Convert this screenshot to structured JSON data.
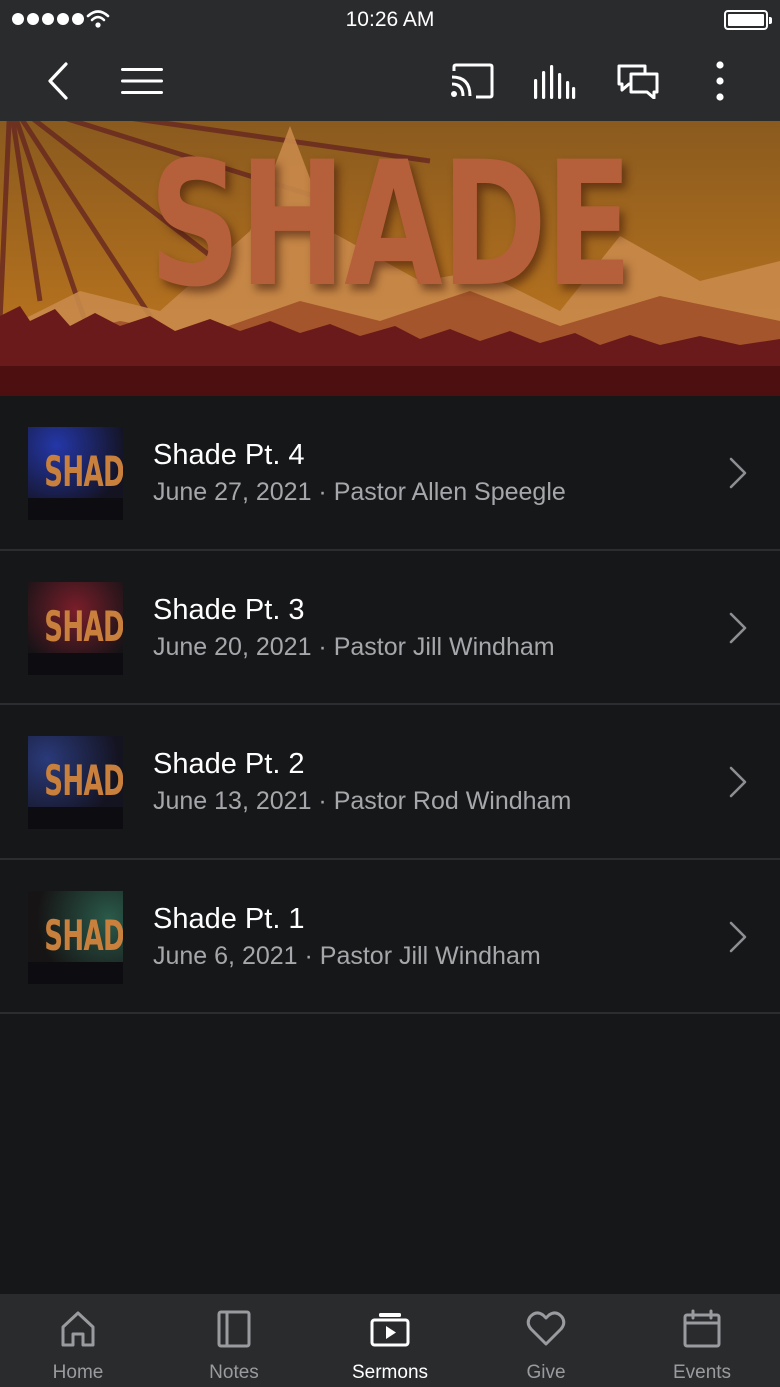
{
  "status_bar": {
    "time": "10:26 AM"
  },
  "hero": {
    "title": "SHADE"
  },
  "sermons": [
    {
      "title": "Shade Pt. 4",
      "subtitle": "June 27, 2021 · Pastor Allen Speegle",
      "thumb_text": "SHADE",
      "thumb_accent": "#2437a8"
    },
    {
      "title": "Shade Pt. 3",
      "subtitle": "June 20, 2021 · Pastor Jill Windham",
      "thumb_text": "SHADE",
      "thumb_accent": "#7a1e2a"
    },
    {
      "title": "Shade Pt. 2",
      "subtitle": "June 13, 2021 · Pastor Rod Windham",
      "thumb_text": "SHADE",
      "thumb_accent": "#2a3a7a"
    },
    {
      "title": "Shade Pt. 1",
      "subtitle": "June 6, 2021 · Pastor Jill Windham",
      "thumb_text": "SHADE",
      "thumb_accent": "#2a5a4a"
    }
  ],
  "tabs": [
    {
      "label": "Home",
      "icon": "home-icon",
      "active": false
    },
    {
      "label": "Notes",
      "icon": "notes-icon",
      "active": false
    },
    {
      "label": "Sermons",
      "icon": "sermons-icon",
      "active": true
    },
    {
      "label": "Give",
      "icon": "heart-icon",
      "active": false
    },
    {
      "label": "Events",
      "icon": "calendar-icon",
      "active": false
    }
  ],
  "colors": {
    "background": "#161719",
    "bar": "#2a2b2d",
    "accent_orange": "#c9803c",
    "subtitle": "#a6a7ab"
  }
}
